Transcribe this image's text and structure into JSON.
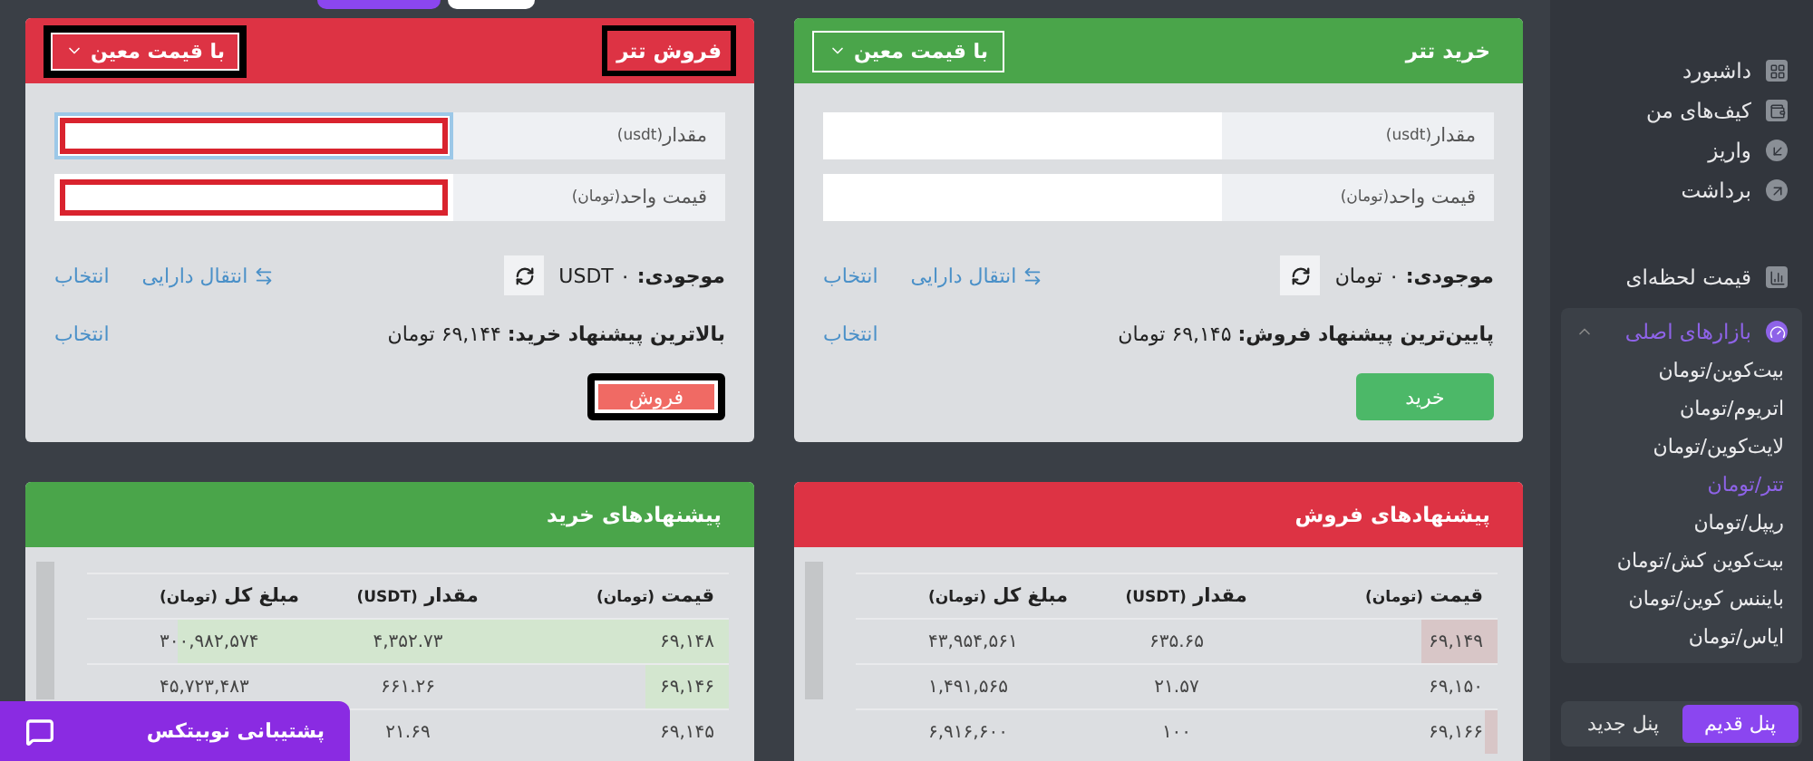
{
  "sidebar": {
    "items": [
      {
        "kind": "dashboard",
        "label": "داشبورد",
        "selected": false
      },
      {
        "kind": "wallet",
        "label": "کیف‌های من",
        "selected": false
      },
      {
        "kind": "deposit",
        "label": "واریز",
        "selected": false
      },
      {
        "kind": "withdraw",
        "label": "برداشت",
        "selected": false
      },
      {
        "kind": "prices",
        "label": "قیمت لحظه‌ای",
        "selected": false
      }
    ],
    "group": {
      "label": "بازارهای اصلی",
      "expanded": true,
      "children": [
        {
          "label": "بیت‌کوین/تومان",
          "selected": false
        },
        {
          "label": "اتریوم/تومان",
          "selected": false
        },
        {
          "label": "لایت‌کوین/تومان",
          "selected": false
        },
        {
          "label": "تتر/تومان",
          "selected": true
        },
        {
          "label": "ریپل/تومان",
          "selected": false
        },
        {
          "label": "بیت‌کوین کش/تومان",
          "selected": false
        },
        {
          "label": "بایننس کوین/تومان",
          "selected": false
        },
        {
          "label": "ایاس/تومان",
          "selected": false
        }
      ]
    },
    "panels": [
      {
        "label": "پنل قدیم",
        "selected": true
      },
      {
        "label": "پنل جدید",
        "selected": false
      }
    ]
  },
  "order_forms": [
    {
      "kind": "buy",
      "title": "خرید تتر",
      "title_highlighted": false,
      "mode": "با قیمت معین",
      "mode_highlighted": false,
      "fields": [
        {
          "label": "مقدار",
          "unit": "(usdt)",
          "focused": false,
          "highlighted": false
        },
        {
          "label": "قیمت واحد",
          "unit": "(تومان)",
          "focused": false,
          "highlighted": false
        }
      ],
      "balance": "**موجودی:** ۰ تومان",
      "transfer": "انتقال دارایی",
      "pick": "انتخاب",
      "best_offer": "**پایین‌ترین پیشنهاد فروش:** ۶۹,۱۴۵ تومان",
      "best_pick": "انتخاب",
      "button": "خرید",
      "button_highlighted": false
    },
    {
      "kind": "sell",
      "title": "فروش تتر",
      "title_highlighted": true,
      "mode": "با قیمت معین",
      "mode_highlighted": true,
      "fields": [
        {
          "label": "مقدار",
          "unit": "(usdt)",
          "focused": true,
          "highlighted": true
        },
        {
          "label": "قیمت واحد",
          "unit": "(تومان)",
          "focused": false,
          "highlighted": true
        }
      ],
      "balance": "**موجودی:** ۰ USDT",
      "transfer": "انتقال دارایی",
      "pick": "انتخاب",
      "best_offer": "**بالاترین پیشنهاد خرید:** ۶۹,۱۴۴ تومان",
      "best_pick": "انتخاب",
      "button": "فروش",
      "button_highlighted": true
    }
  ],
  "order_books": [
    {
      "kind": "sell",
      "title": "پیشنهادهای فروش",
      "columns": [
        {
          "label": "قیمت",
          "unit": "(تومان)"
        },
        {
          "label": "مقدار",
          "unit": "(USDT)"
        },
        {
          "label": "مبلغ کل",
          "unit": "(تومان)"
        }
      ],
      "rows": [
        {
          "price": "۶۹,۱۴۹",
          "amount": "۶۳۵.۶۵",
          "total": "۴۳,۹۵۴,۵۶۱",
          "level": 0.12
        },
        {
          "price": "۶۹,۱۵۰",
          "amount": "۲۱.۵۷",
          "total": "۱,۴۹۱,۵۶۵"
        },
        {
          "price": "۶۹,۱۶۶",
          "amount": "۱۰۰",
          "total": "۶,۹۱۶,۶۰۰",
          "level": 0.02
        }
      ]
    },
    {
      "kind": "buy",
      "title": "پیشنهادهای خرید",
      "columns": [
        {
          "label": "قیمت",
          "unit": "(تومان)"
        },
        {
          "label": "مقدار",
          "unit": "(USDT)"
        },
        {
          "label": "مبلغ کل",
          "unit": "(تومان)"
        }
      ],
      "rows": [
        {
          "price": "۶۹,۱۴۸",
          "amount": "۴,۳۵۲.۷۳",
          "total": "۳۰۰,۹۸۲,۵۷۴",
          "level": 0.86
        },
        {
          "price": "۶۹,۱۴۶",
          "amount": "۶۶۱.۲۶",
          "total": "۴۵,۷۲۳,۴۸۳",
          "level": 0.13
        },
        {
          "price": "۶۹,۱۴۵",
          "amount": "۲۱.۶۹"
        }
      ]
    }
  ],
  "support": {
    "label": "پشتیبانی نوبیتکس"
  }
}
